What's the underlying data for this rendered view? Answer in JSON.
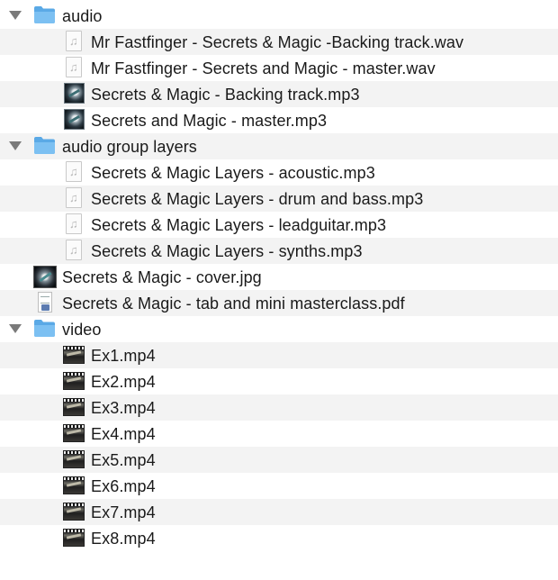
{
  "window": {
    "rows": [
      {
        "kind": "folder",
        "level": 0,
        "expanded": true,
        "icon": "folder-icon",
        "name": "audio"
      },
      {
        "kind": "audio-doc",
        "level": 1,
        "icon": "audio-file-icon",
        "name": "Mr Fastfinger - Secrets & Magic -Backing track.wav"
      },
      {
        "kind": "audio-doc",
        "level": 1,
        "icon": "audio-file-icon",
        "name": "Mr Fastfinger - Secrets and Magic - master.wav"
      },
      {
        "kind": "art",
        "level": 1,
        "icon": "album-art-icon",
        "name": "Secrets & Magic - Backing track.mp3"
      },
      {
        "kind": "art",
        "level": 1,
        "icon": "album-art-icon",
        "name": "Secrets and Magic - master.mp3"
      },
      {
        "kind": "folder",
        "level": 0,
        "expanded": true,
        "icon": "folder-icon",
        "name": "audio group layers"
      },
      {
        "kind": "audio-doc",
        "level": 1,
        "icon": "audio-file-icon",
        "name": "Secrets & Magic Layers - acoustic.mp3"
      },
      {
        "kind": "audio-doc",
        "level": 1,
        "icon": "audio-file-icon",
        "name": "Secrets & Magic Layers - drum and bass.mp3"
      },
      {
        "kind": "audio-doc",
        "level": 1,
        "icon": "audio-file-icon",
        "name": "Secrets & Magic Layers - leadguitar.mp3"
      },
      {
        "kind": "audio-doc",
        "level": 1,
        "icon": "audio-file-icon",
        "name": "Secrets & Magic Layers - synths.mp3"
      },
      {
        "kind": "cover",
        "level": 0,
        "icon": "image-thumbnail-icon",
        "name": "Secrets & Magic - cover.jpg"
      },
      {
        "kind": "pdf",
        "level": 0,
        "icon": "pdf-file-icon",
        "name": "Secrets & Magic - tab and mini masterclass.pdf"
      },
      {
        "kind": "folder",
        "level": 0,
        "expanded": true,
        "icon": "folder-icon",
        "name": "video"
      },
      {
        "kind": "video",
        "level": 1,
        "icon": "video-thumbnail-icon",
        "name": "Ex1.mp4"
      },
      {
        "kind": "video",
        "level": 1,
        "icon": "video-thumbnail-icon",
        "name": "Ex2.mp4"
      },
      {
        "kind": "video",
        "level": 1,
        "icon": "video-thumbnail-icon",
        "name": "Ex3.mp4"
      },
      {
        "kind": "video",
        "level": 1,
        "icon": "video-thumbnail-icon",
        "name": "Ex4.mp4"
      },
      {
        "kind": "video",
        "level": 1,
        "icon": "video-thumbnail-icon",
        "name": "Ex5.mp4"
      },
      {
        "kind": "video",
        "level": 1,
        "icon": "video-thumbnail-icon",
        "name": "Ex6.mp4"
      },
      {
        "kind": "video",
        "level": 1,
        "icon": "video-thumbnail-icon",
        "name": "Ex7.mp4"
      },
      {
        "kind": "video",
        "level": 1,
        "icon": "video-thumbnail-icon",
        "name": "Ex8.mp4"
      }
    ]
  },
  "colors": {
    "alt_row": "#f3f3f3",
    "folder_blue": "#5aa9e6",
    "text": "#1a1a1a",
    "disclosure": "#7a7a7a"
  }
}
